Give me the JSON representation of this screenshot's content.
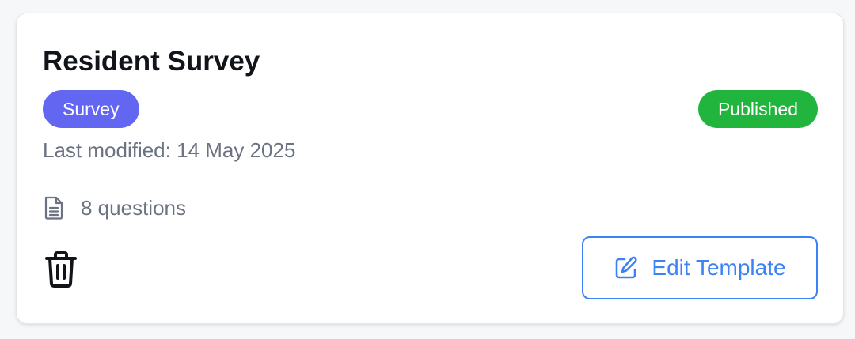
{
  "card": {
    "title": "Resident Survey",
    "type_badge": "Survey",
    "status_badge": "Published",
    "last_modified": "Last modified: 14 May 2025",
    "questions": "8 questions",
    "edit_button_label": "Edit Template"
  },
  "icons": {
    "document": "document-icon",
    "trash": "trash-icon",
    "edit": "pencil-square-icon"
  },
  "colors": {
    "type_badge_bg": "#6366f1",
    "status_badge_bg": "#22b53d",
    "accent_blue": "#3b82f6",
    "muted_text": "#6b7280",
    "title_text": "#111418"
  }
}
